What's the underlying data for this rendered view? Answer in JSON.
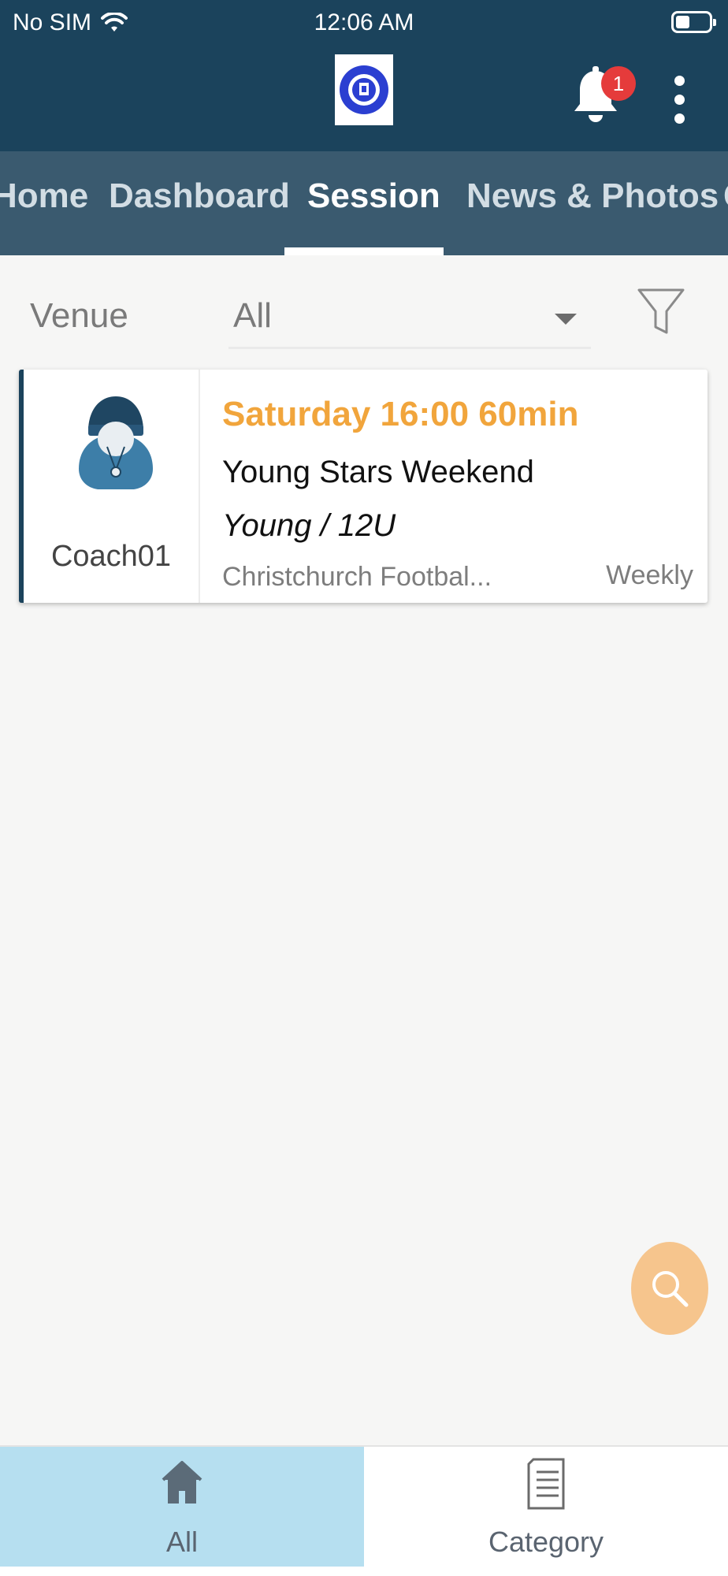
{
  "status_bar": {
    "carrier": "No SIM",
    "time": "12:06 AM"
  },
  "header": {
    "logo": "Christchurch Football Club crest",
    "notification_count": "1"
  },
  "tabs": [
    {
      "label": "Home"
    },
    {
      "label": "Dashboard"
    },
    {
      "label": "Session"
    },
    {
      "label": "News & Photos"
    },
    {
      "label": "C"
    }
  ],
  "active_tab": "Session",
  "filter": {
    "venue_label": "Venue",
    "venue_value": "All"
  },
  "sessions": [
    {
      "coach": "Coach01",
      "time": "Saturday 16:00 60min",
      "name": "Young Stars Weekend",
      "group": "Young / 12U",
      "venue": "Christchurch Footbal...",
      "frequency": "Weekly"
    }
  ],
  "bottom_nav": {
    "all_label": "All",
    "category_label": "Category",
    "active": "All"
  },
  "colors": {
    "header": "#1b435c",
    "tabbar": "#3a5a6f",
    "accent_orange": "#f1a53c",
    "fab": "#f6c58d",
    "nav_active": "#b6dff0"
  }
}
